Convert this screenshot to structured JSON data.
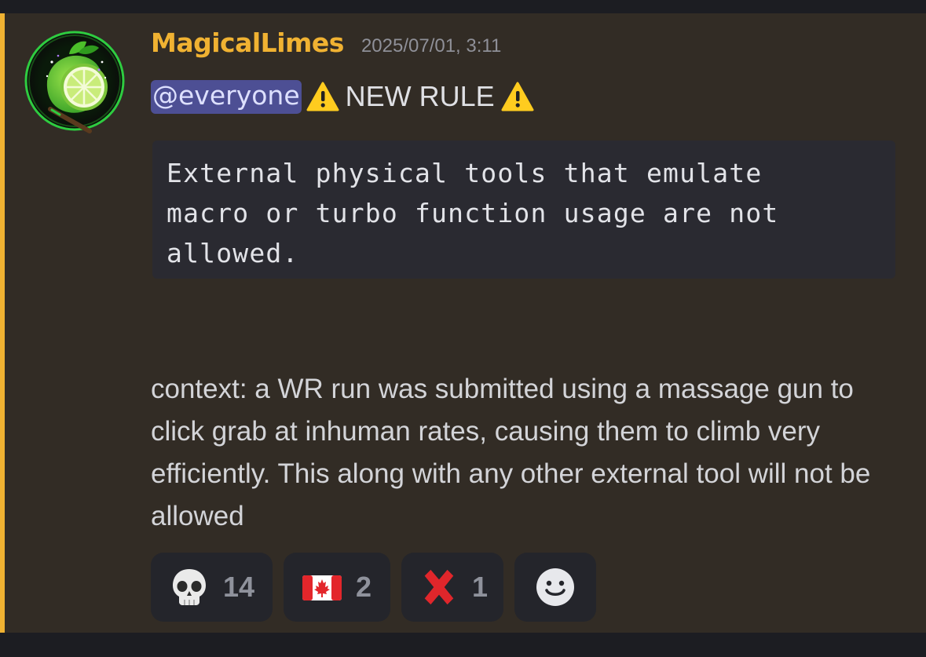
{
  "message": {
    "author": "MagicalLimes",
    "timestamp": "2025/07/01, 3:11",
    "mention": "@everyone",
    "title": "NEW RULE",
    "title_icon": "warning-icon",
    "code_block": "External physical tools that emulate\nmacro or turbo function usage are not\nallowed.",
    "body": "context: a WR run was submitted using a massage gun to click grab at inhuman rates, causing them to climb very efficiently. This along with any other external tool will not be allowed"
  },
  "reactions": [
    {
      "emoji": "skull-icon",
      "count": "14"
    },
    {
      "emoji": "canada-flag-icon",
      "count": "2"
    },
    {
      "emoji": "red-x-icon",
      "count": "1"
    },
    {
      "emoji": "add-reaction-smiley-icon",
      "count": ""
    }
  ],
  "colors": {
    "username": "#f0b232",
    "highlight_bar": "#f0b232",
    "message_bg": "#322c25",
    "mention_bg": "#4d4f94"
  }
}
